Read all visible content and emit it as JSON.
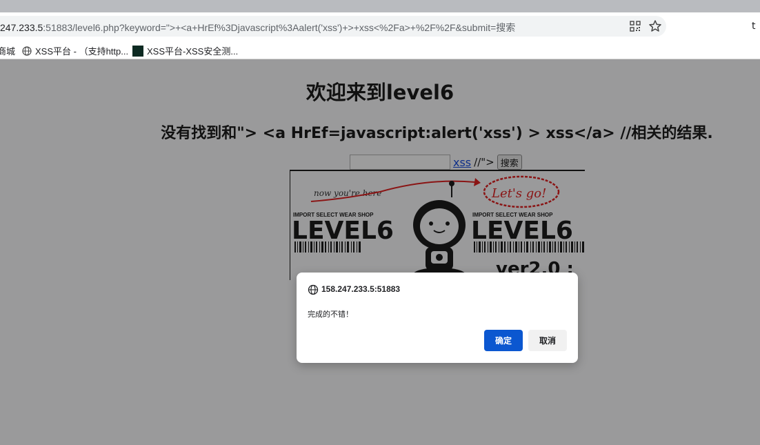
{
  "browser": {
    "url_host": "247.233.5",
    "url_rest": ":51883/level6.php?keyword=\">+<a+HrEf%3Djavascript%3Aalert('xss')+>+xss<%2Fa>+%2F%2F&submit=搜索",
    "bookmarks": [
      {
        "label": "商城",
        "icon": "none"
      },
      {
        "label": "XSS平台 - （支持http...",
        "icon": "globe-icon"
      },
      {
        "label": "XSS平台-XSS安全测...",
        "icon": "site-thumbnail"
      }
    ]
  },
  "page": {
    "welcome": "欢迎来到level6",
    "result": "没有找到和\"> <a HrEf=javascript:alert('xss') > xss</a> //相关的结果.",
    "link_text": "xss",
    "link_tail": "//\">",
    "search_button": "搜索",
    "poster": {
      "handwritten_left": "now you're here",
      "handwritten_right": "Let's go!",
      "brand": "IMPORT SELECT WEAR SHOP",
      "level_text": "LEVEL6",
      "version": "ver2.0 :"
    }
  },
  "dialog": {
    "origin": "158.247.233.5:51883",
    "message": "完成的不错！",
    "ok_label": "确定",
    "cancel_label": "取消",
    "ok_color": "#0b57d0"
  }
}
